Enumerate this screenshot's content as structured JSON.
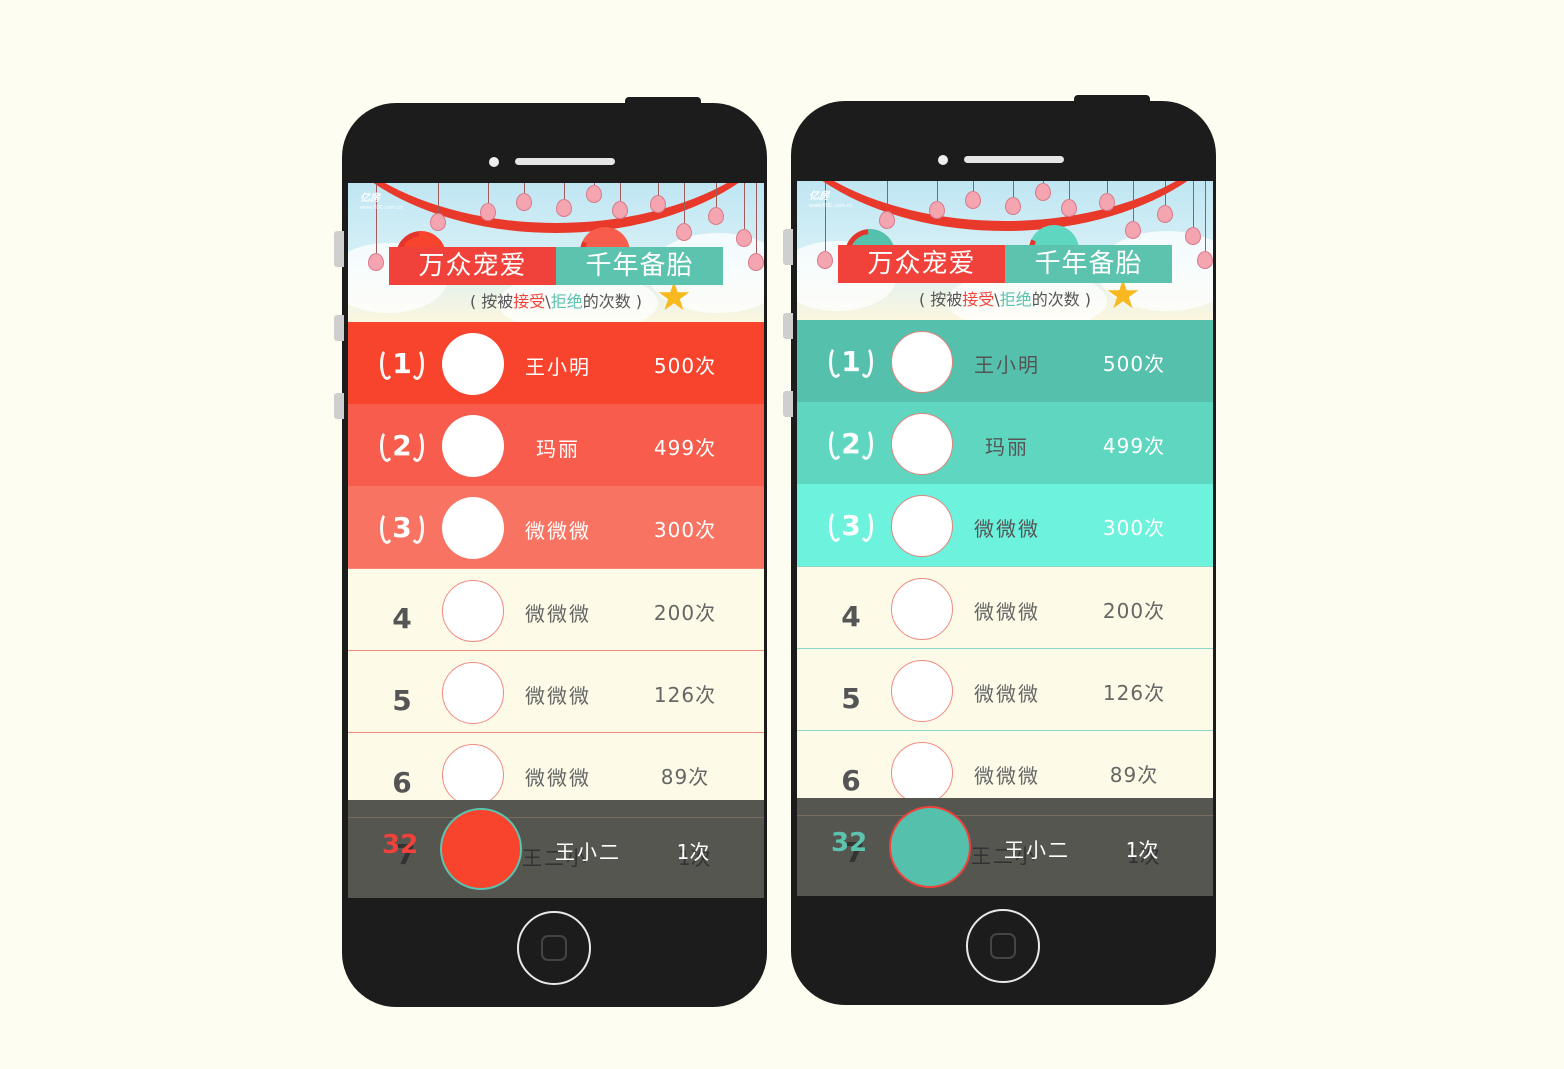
{
  "banner": {
    "logo": "亿房",
    "logo_url": "www.FDC.com.cn",
    "title_left": "万众宠爱",
    "title_right": "千年备胎",
    "subtitle_prefix": "( 按被",
    "subtitle_accept": "接受",
    "subtitle_sep": "\\",
    "subtitle_reject": "拒绝",
    "subtitle_suffix": "的次数 )"
  },
  "rows": [
    {
      "rank": "1",
      "name": "王小明",
      "count": "500次"
    },
    {
      "rank": "2",
      "name": "玛丽",
      "count": "499次"
    },
    {
      "rank": "3",
      "name": "微微微",
      "count": "300次"
    },
    {
      "rank": "4",
      "name": "微微微",
      "count": "200次"
    },
    {
      "rank": "5",
      "name": "微微微",
      "count": "126次"
    },
    {
      "rank": "6",
      "name": "微微微",
      "count": "89次"
    }
  ],
  "ghost_row": {
    "rank": "7",
    "name": "王二小",
    "count": "1次"
  },
  "me": {
    "rank": "32",
    "name": "王小二",
    "count": "1次"
  },
  "colors": {
    "red_theme": "#f8432d",
    "teal_theme": "#55c0ac",
    "background": "#fdfdf1",
    "phone": "#1c1c1c"
  }
}
